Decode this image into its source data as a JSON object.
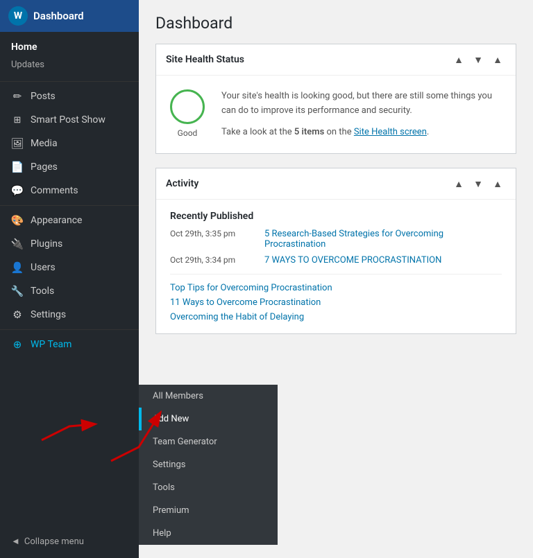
{
  "sidebar": {
    "header": {
      "logo": "W",
      "title": "Dashboard"
    },
    "home_label": "Home",
    "updates_label": "Updates",
    "nav_items": [
      {
        "id": "posts",
        "label": "Posts",
        "icon": "✏"
      },
      {
        "id": "smart-post-show",
        "label": "Smart Post Show",
        "icon": "⊞"
      },
      {
        "id": "media",
        "label": "Media",
        "icon": "⊡"
      },
      {
        "id": "pages",
        "label": "Pages",
        "icon": "📄"
      },
      {
        "id": "comments",
        "label": "Comments",
        "icon": "💬"
      },
      {
        "id": "appearance",
        "label": "Appearance",
        "icon": "🎨"
      },
      {
        "id": "plugins",
        "label": "Plugins",
        "icon": "🔌"
      },
      {
        "id": "users",
        "label": "Users",
        "icon": "👤"
      },
      {
        "id": "tools",
        "label": "Tools",
        "icon": "🔧"
      },
      {
        "id": "settings",
        "label": "Settings",
        "icon": "⚙"
      },
      {
        "id": "wp-team",
        "label": "WP Team",
        "icon": "⊕"
      }
    ],
    "collapse_label": "Collapse menu"
  },
  "submenu": {
    "items": [
      {
        "id": "all-members",
        "label": "All Members",
        "highlighted": false
      },
      {
        "id": "add-new",
        "label": "Add New",
        "highlighted": true
      },
      {
        "id": "team-generator",
        "label": "Team Generator",
        "highlighted": false
      },
      {
        "id": "settings",
        "label": "Settings",
        "highlighted": false
      },
      {
        "id": "tools",
        "label": "Tools",
        "highlighted": false
      },
      {
        "id": "premium",
        "label": "Premium",
        "highlighted": false
      },
      {
        "id": "help",
        "label": "Help",
        "highlighted": false
      }
    ]
  },
  "main": {
    "page_title": "Dashboard",
    "site_health": {
      "title": "Site Health Status",
      "indicator_label": "Good",
      "description": "Your site's health is looking good, but there are still some things you can do to improve its performance and security.",
      "cta_text": "Take a look at the ",
      "cta_bold": "5 items",
      "cta_middle": " on the ",
      "cta_link": "Site Health screen",
      "cta_end": "."
    },
    "activity": {
      "title": "Activity",
      "recently_published_label": "Recently Published",
      "items": [
        {
          "date": "Oct 29th, 3:35 pm",
          "link": "5 Research-Based Strategies for Overcoming Procrastination"
        },
        {
          "date": "Oct 29th, 3:34 pm",
          "link": "7 WAYS TO OVERCOME PROCRASTINATION"
        }
      ],
      "extra_links": [
        "Top Tips for Overcoming Procrastination",
        "11 Ways to Overcome Procrastination",
        "Overcoming the Habit of Delaying"
      ]
    }
  }
}
